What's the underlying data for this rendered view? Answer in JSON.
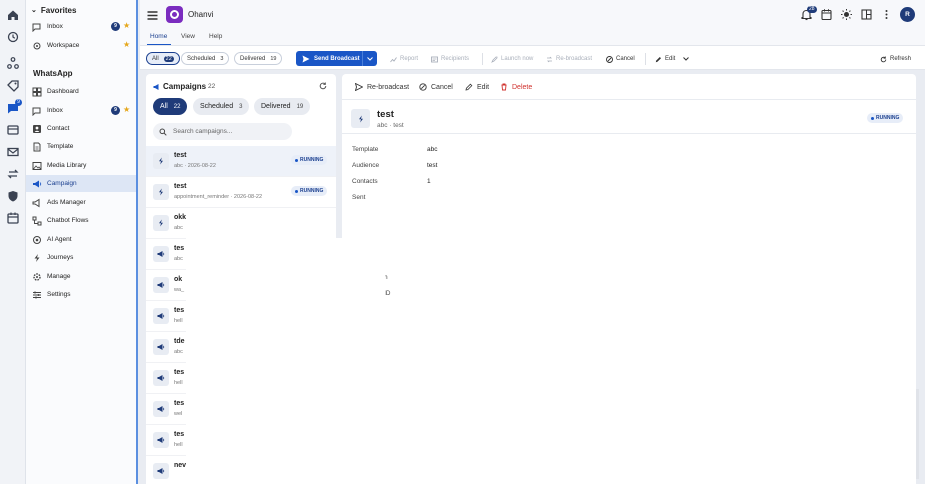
{
  "app": {
    "name": "Ohanvi",
    "notification_count": "28",
    "avatar_initial": "R"
  },
  "favorites": {
    "title": "Favorites",
    "items": [
      {
        "label": "Inbox",
        "badge": "9",
        "starred": true
      },
      {
        "label": "Workspace",
        "badge": "",
        "starred": true
      }
    ]
  },
  "whatsapp": {
    "title": "WhatsApp",
    "items": [
      {
        "label": "Dashboard"
      },
      {
        "label": "Inbox",
        "badge": "9"
      },
      {
        "label": "Contact"
      },
      {
        "label": "Template"
      },
      {
        "label": "Media Library"
      },
      {
        "label": "Campaign"
      },
      {
        "label": "Ads Manager"
      },
      {
        "label": "Chatbot Flows"
      },
      {
        "label": "AI Agent"
      },
      {
        "label": "Journeys"
      },
      {
        "label": "Manage"
      },
      {
        "label": "Settings"
      }
    ],
    "active": "Campaign"
  },
  "rail_badge": "9",
  "ribbon_tabs": [
    "Home",
    "View",
    "Help"
  ],
  "toolbar": {
    "filters": [
      {
        "label": "All",
        "count": "22"
      },
      {
        "label": "Scheduled",
        "count": "3"
      },
      {
        "label": "Delivered",
        "count": "19"
      }
    ],
    "send_broadcast": "Send Broadcast",
    "report": "Report",
    "recipients": "Recipients",
    "launch_now": "Launch now",
    "rebroadcast": "Re-broadcast",
    "cancel": "Cancel",
    "edit": "Edit",
    "refresh": "Refresh"
  },
  "list": {
    "title": "Campaigns",
    "count": "22",
    "filters": [
      {
        "label": "All",
        "count": "22"
      },
      {
        "label": "Scheduled",
        "count": "3"
      },
      {
        "label": "Delivered",
        "count": "19"
      }
    ],
    "search_placeholder": "Search campaigns...",
    "rows": [
      {
        "title": "test",
        "sub": "abc · 2026-08-22",
        "status": "RUNNING",
        "icon": "bolt"
      },
      {
        "title": "test",
        "sub": "appointment_reminder · 2026-08-22",
        "status": "RUNNING",
        "icon": "bolt"
      },
      {
        "title": "okk",
        "sub": "abc",
        "status": "",
        "icon": "bolt"
      },
      {
        "title": "tes",
        "sub": "abc",
        "status": "",
        "icon": "megaphone"
      },
      {
        "title": "ok",
        "sub": "wa_",
        "status": "",
        "icon": "megaphone"
      },
      {
        "title": "tes",
        "sub": "hell",
        "status": "",
        "icon": "megaphone"
      },
      {
        "title": "tde",
        "sub": "abc",
        "status": "",
        "icon": "megaphone"
      },
      {
        "title": "tes",
        "sub": "hell",
        "status": "",
        "icon": "megaphone"
      },
      {
        "title": "tes",
        "sub": "wel",
        "status": "",
        "icon": "megaphone"
      },
      {
        "title": "tes",
        "sub": "hell",
        "status": "",
        "icon": "megaphone"
      },
      {
        "title": "nev",
        "sub": "",
        "status": "",
        "icon": "megaphone"
      }
    ]
  },
  "detail": {
    "actions": {
      "rebroadcast": "Re-broadcast",
      "cancel": "Cancel",
      "edit": "Edit",
      "delete": "Delete"
    },
    "title": "test",
    "template": "abc",
    "audience": "test",
    "status": "RUNNING",
    "fields": [
      {
        "label": "Template",
        "value": "abc"
      },
      {
        "label": "Audience",
        "value": "test"
      },
      {
        "label": "Contacts",
        "value": "1"
      },
      {
        "label": "Sent",
        "value": ""
      }
    ],
    "partial_labels": [
      "n",
      "ID"
    ]
  },
  "colors": {
    "accent": "#1a56c6",
    "navy": "#1f3b79",
    "danger": "#d0312d",
    "brand": "#7b2cbf"
  }
}
